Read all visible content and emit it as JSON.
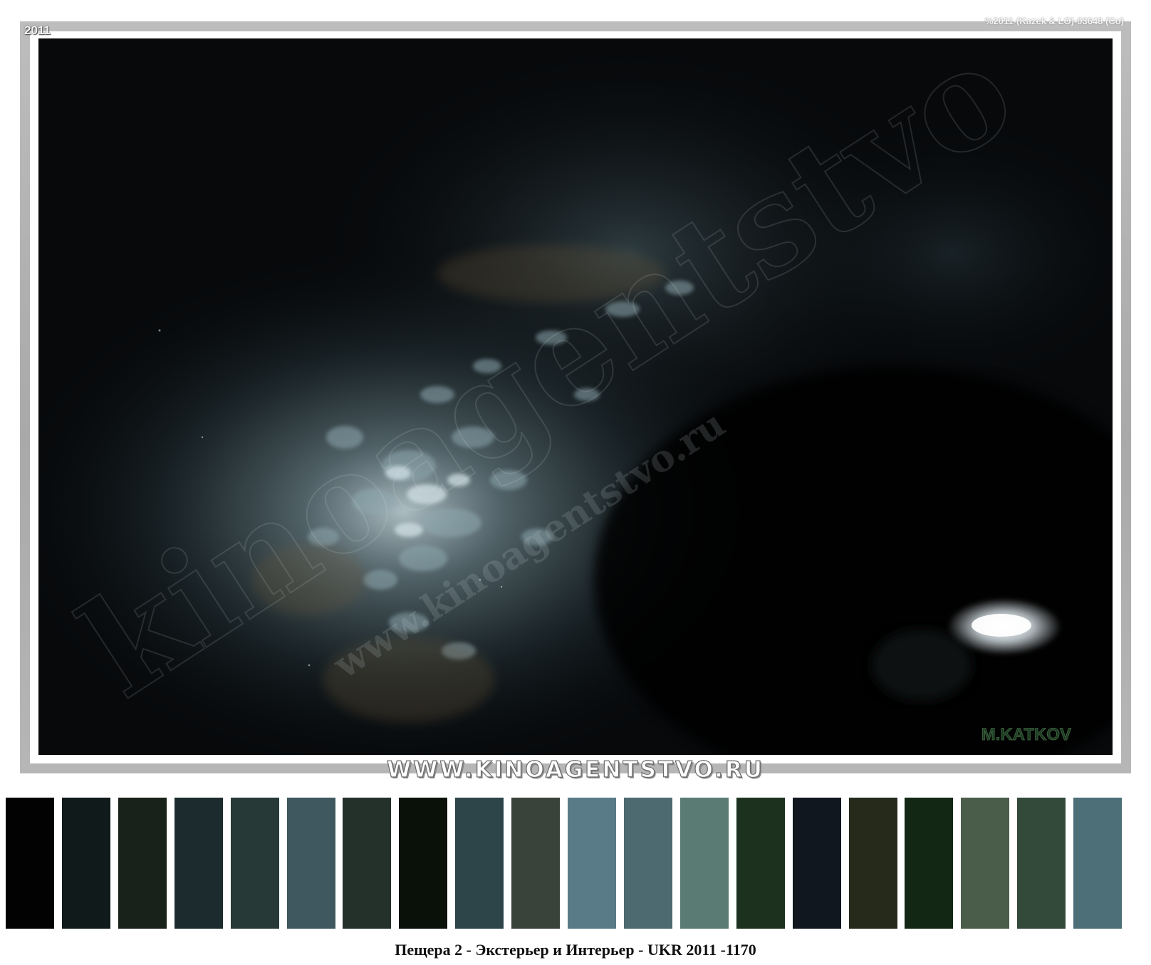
{
  "photo": {
    "year_label": "2011",
    "copyright_label": "%2011-(Kazek & LO)-03648 (Co)",
    "watermark_large": "kinoagentstvo",
    "watermark_url": "www.kinoagentstvo.ru",
    "author_signature": "M.KATKOV",
    "colors": {
      "background": "#050709",
      "lit_rock": "#9fb8c0",
      "highlight": "#d8e6ea",
      "lamp": "#f5fbff"
    }
  },
  "banner": {
    "text": "WWW.KINOAGENTSTVO.RU"
  },
  "palette": {
    "swatches": [
      "#020202",
      "#111a1a",
      "#18221a",
      "#1c2b2d",
      "#273937",
      "#3f575e",
      "#24302a",
      "#091109",
      "#2d4549",
      "#3a433a",
      "#587b87",
      "#4c6a70",
      "#5a7a74",
      "#1c321f",
      "#10171f",
      "#252a1b",
      "#132715",
      "#4a5c4a",
      "#33493a",
      "#4d6f78"
    ]
  },
  "caption": {
    "text": "Пещера 2 - Экстерьер и Интерьер - UKR 2011 -1170"
  }
}
